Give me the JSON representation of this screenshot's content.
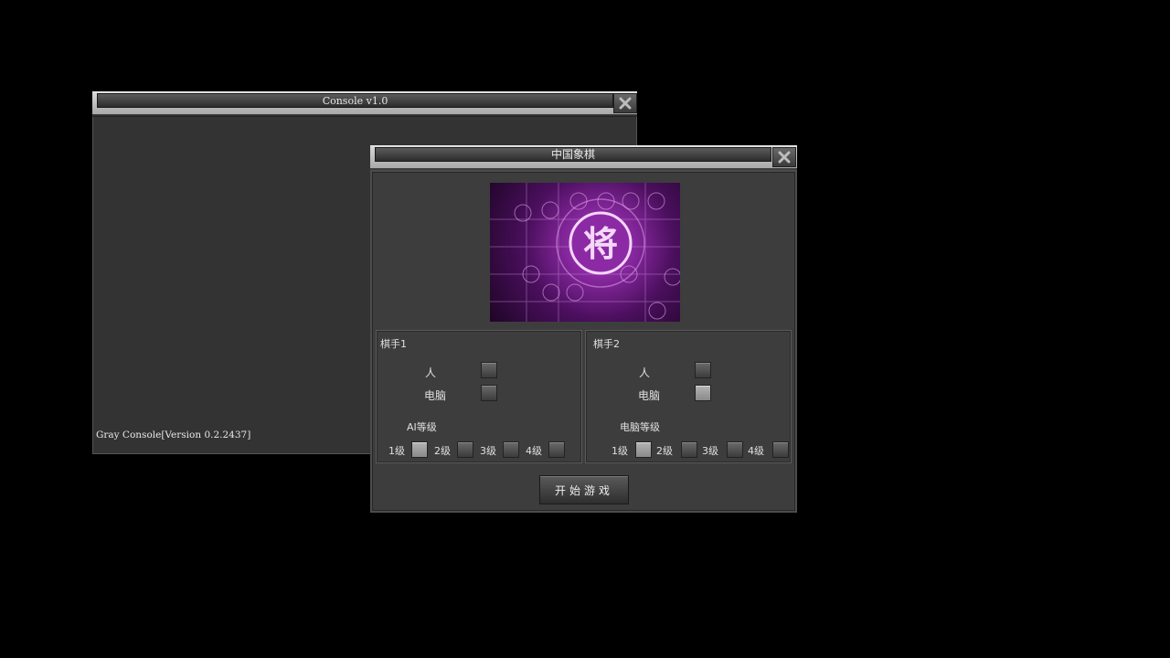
{
  "console_window": {
    "title": "Console v1.0",
    "close_icon": "close-x-icon",
    "output_line": "Gray Console[Version 0.2.2437]"
  },
  "chess_window": {
    "title": "中国象棋",
    "close_icon": "close-x-icon",
    "logo_glyph": "将",
    "player1": {
      "title": "棋手1",
      "human_label": "人",
      "computer_label": "电脑",
      "human_checked": false,
      "computer_checked": false,
      "level_title": "AI等级",
      "levels": [
        "1级",
        "2级",
        "3级",
        "4级"
      ],
      "selected_level": "1级"
    },
    "player2": {
      "title": "棋手2",
      "human_label": "人",
      "computer_label": "电脑",
      "human_checked": false,
      "computer_checked": true,
      "level_title": "电脑等级",
      "levels": [
        "1级",
        "2级",
        "3级",
        "4级"
      ],
      "selected_level": "1级"
    },
    "start_button": "开始游戏"
  },
  "colors": {
    "desktop_background": "#000000",
    "window_body": "#3d3d3d",
    "title_bar": "#b0b0b0",
    "logo_accent": "#a23bbd"
  }
}
